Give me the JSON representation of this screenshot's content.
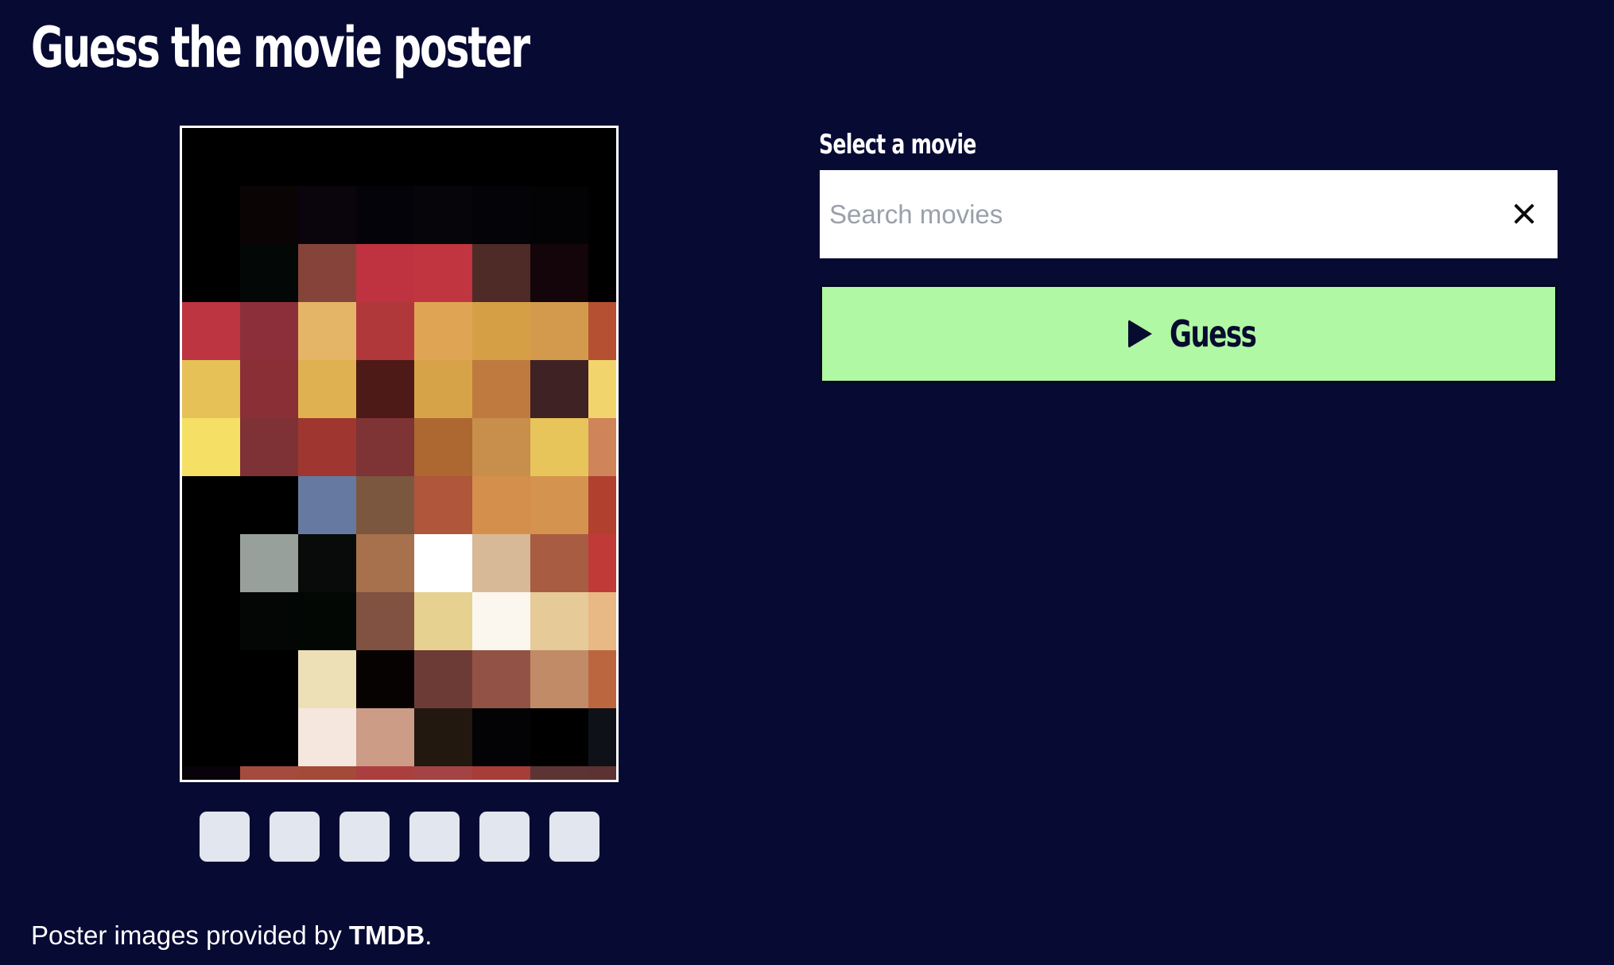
{
  "page": {
    "title": "Guess the movie poster",
    "background": "#070a33"
  },
  "poster": {
    "columns": 8,
    "rows": 12,
    "border_color": "#ffffff",
    "cells": [
      "#000000",
      "#000000",
      "#000000",
      "#000000",
      "#000000",
      "#000000",
      "#000000",
      "#000000",
      "#000000",
      "#0a0405",
      "#0a050d",
      "#05030a",
      "#05050a",
      "#030308",
      "#030305",
      "#000000",
      "#000000",
      "#030806",
      "#854339",
      "#be333f",
      "#c0353f",
      "#4e2b27",
      "#13050a",
      "#000000",
      "#bd3540",
      "#8d2e3b",
      "#e5b567",
      "#b0383b",
      "#e0a455",
      "#d5a045",
      "#d39a4d",
      "#b55032",
      "#e5c158",
      "#8a2f35",
      "#e0b151",
      "#4e1a17",
      "#d7a348",
      "#be7a3f",
      "#3f2223",
      "#f2d46c",
      "#f5df65",
      "#7f3235",
      "#9f3730",
      "#7e3335",
      "#ac6830",
      "#c78e4c",
      "#e8c55a",
      "#cf8459",
      "#000000",
      "#000000",
      "#667aa1",
      "#7c573f",
      "#af563b",
      "#d58f4d",
      "#d59350",
      "#b2402f",
      "#000000",
      "#98a09c",
      "#080b0a",
      "#a6714c",
      "#ffffff",
      "#d8b997",
      "#a85d43",
      "#c03a38",
      "#000000",
      "#030605",
      "#030704",
      "#815141",
      "#e7d190",
      "#fbf6ee",
      "#e6ca98",
      "#e8b985",
      "#000000",
      "#000000",
      "#ede0b6",
      "#060201",
      "#6d3b35",
      "#925346",
      "#c28b68",
      "#bb663f",
      "#000000",
      "#000000",
      "#f5e7de",
      "#cc9c87",
      "#231810",
      "#030305",
      "#000000",
      "#0e1218",
      "#08030a",
      "#a44b3e",
      "#a34a38",
      "#ab3f40",
      "#a34343",
      "#a63d39",
      "#5c3434",
      "#5c3232"
    ]
  },
  "attempts": {
    "count": 6,
    "color": "#e2e6ef"
  },
  "search": {
    "label": "Select a movie",
    "placeholder": "Search movies",
    "value": ""
  },
  "actions": {
    "guess_label": "Guess",
    "guess_color": "#b0f8a3"
  },
  "footer": {
    "text_before": "Poster images provided by ",
    "brand": "TMDB",
    "text_after": "."
  }
}
